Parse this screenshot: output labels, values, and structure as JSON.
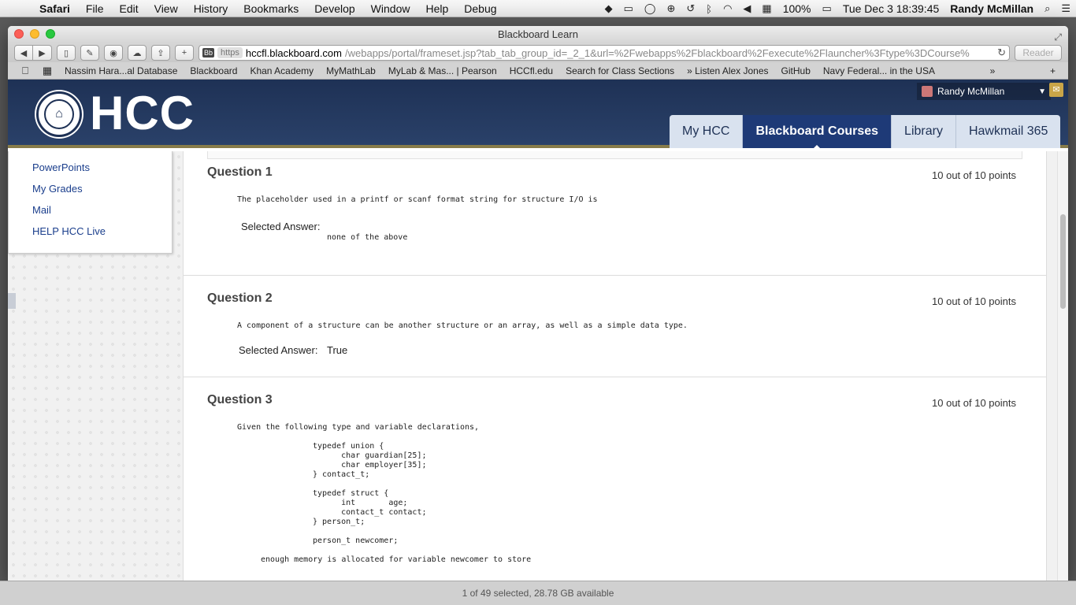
{
  "menubar": {
    "app": "Safari",
    "items": [
      "File",
      "Edit",
      "View",
      "History",
      "Bookmarks",
      "Develop",
      "Window",
      "Help",
      "Debug"
    ],
    "battery": "100%",
    "datetime": "Tue Dec 3  18:39:45",
    "user": "Randy McMillan"
  },
  "window": {
    "title": "Blackboard Learn",
    "url_secure": "https",
    "url_domain": "hccfl.blackboard.com",
    "url_path": "/webapps/portal/frameset.jsp?tab_tab_group_id=_2_1&url=%2Fwebapps%2Fblackboard%2Fexecute%2Flauncher%3Ftype%3DCourse%",
    "reader": "Reader",
    "favicon": "Bb"
  },
  "bookmarks": [
    "Nassim Hara...al Database",
    "Blackboard",
    "Khan Academy",
    "MyMathLab",
    "MyLab & Mas... | Pearson",
    "HCCfl.edu",
    "Search for Class Sections",
    "» Listen Alex Jones",
    "GitHub",
    "Navy Federal... in the USA"
  ],
  "header": {
    "logo": "HCC",
    "user": "Randy McMillan",
    "tabs": [
      "My HCC",
      "Blackboard Courses",
      "Library",
      "Hawkmail 365"
    ]
  },
  "leftmenu": [
    "PowerPoints",
    "My Grades",
    "Mail",
    "HELP HCC Live"
  ],
  "questions": [
    {
      "title": "Question 1",
      "points": "10 out of 10 points",
      "text": "The placeholder used in a printf or scanf format string for structure I/O is",
      "selected_label": "Selected Answer:",
      "selected_value": "none of the above"
    },
    {
      "title": "Question 2",
      "points": "10 out of 10 points",
      "text": "A component of a structure can be another structure or an array, as well as a simple data type.",
      "selected_label": "Selected Answer:",
      "selected_value": "True"
    },
    {
      "title": "Question 3",
      "points": "10 out of 10 points",
      "text": "Given the following type and variable declarations,",
      "code": "typedef union {\n      char guardian[25];\n      char employer[35];\n} contact_t;\n\ntypedef struct {\n      int       age;\n      contact_t contact;\n} person_t;\n\nperson_t newcomer;",
      "after": "enough memory is allocated for variable newcomer to store"
    }
  ],
  "statusbar": "1 of 49 selected, 28.78 GB available"
}
